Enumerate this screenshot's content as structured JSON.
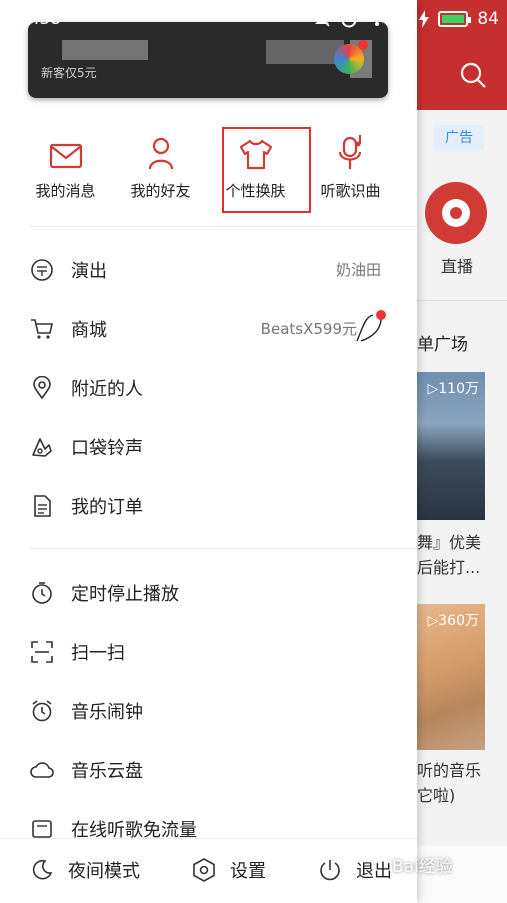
{
  "status_bar": {
    "time": "09:38",
    "battery": "84"
  },
  "background": {
    "ad_label": "广告",
    "live_label": "直播",
    "plaza_label": "单广场",
    "card1_count": "▷110万",
    "card1_title_line1": "舞』优美",
    "card1_title_line2": "后能打...",
    "card2_count": "▷360万",
    "card2_title_line1": "听的音乐",
    "card2_title_line2": "它啦)"
  },
  "banner": {
    "subtitle": "新客仅5元"
  },
  "quick_actions": [
    {
      "label": "我的消息",
      "icon": "mail-icon"
    },
    {
      "label": "我的好友",
      "icon": "person-icon"
    },
    {
      "label": "个性换肤",
      "icon": "tshirt-icon"
    },
    {
      "label": "听歌识曲",
      "icon": "mic-note-icon"
    }
  ],
  "menu_group1": [
    {
      "label": "演出",
      "right": "奶油田",
      "icon": "ticket-icon"
    },
    {
      "label": "商城",
      "right": "BeatsX599元",
      "icon": "cart-icon"
    },
    {
      "label": "附近的人",
      "icon": "location-icon"
    },
    {
      "label": "口袋铃声",
      "icon": "ringtone-icon"
    },
    {
      "label": "我的订单",
      "icon": "order-icon"
    }
  ],
  "menu_group2": [
    {
      "label": "定时停止播放",
      "icon": "timer-icon"
    },
    {
      "label": "扫一扫",
      "icon": "scan-icon"
    },
    {
      "label": "音乐闹钟",
      "icon": "alarm-icon"
    },
    {
      "label": "音乐云盘",
      "icon": "cloud-icon"
    },
    {
      "label": "在线听歌免流量",
      "icon": "sim-icon"
    }
  ],
  "bottom_bar": {
    "night": "夜间模式",
    "settings": "设置",
    "exit": "退出"
  },
  "watermark": "Bai经验",
  "colors": {
    "accent": "#d23a36",
    "highlight_box": "#e0302b"
  }
}
